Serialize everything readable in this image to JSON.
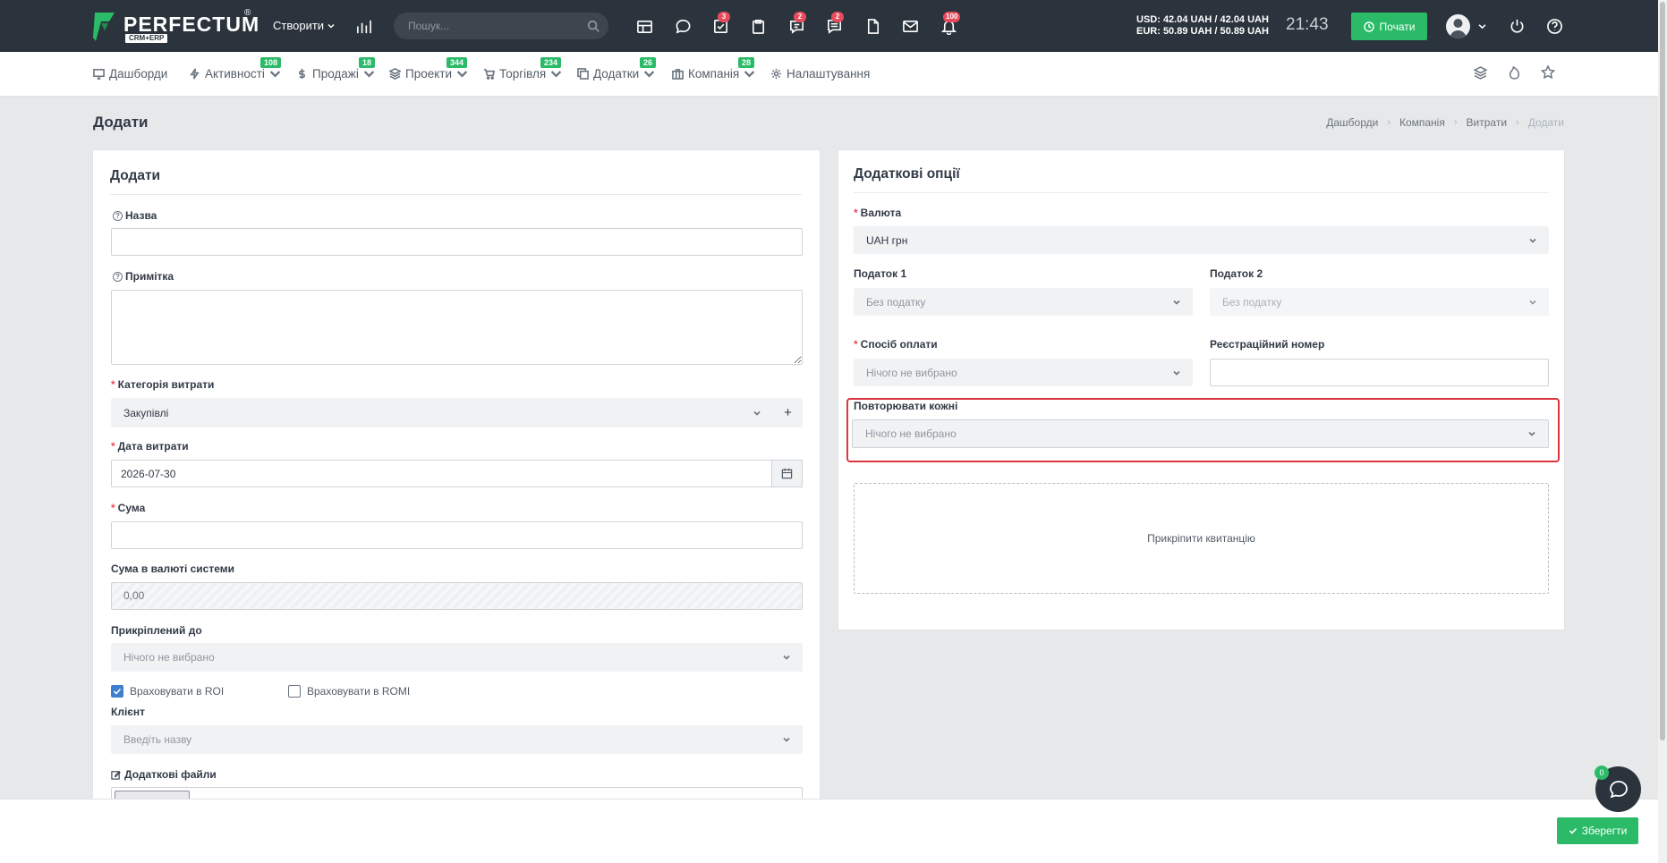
{
  "app": {
    "name": "PERFECTUM",
    "sub": "CRM+ERP",
    "reg": "®"
  },
  "topbar": {
    "create_label": "Створити",
    "search_placeholder": "Пошук...",
    "badges": {
      "tasks": "3",
      "comments": "2",
      "messages": "2",
      "notifications": "100"
    },
    "rates_usd": "USD: 42.04 UAH / 42.04 UAH",
    "rates_eur": "EUR: 50.89 UAH / 50.89 UAH",
    "time": "21:43",
    "start_label": "Почати"
  },
  "nav": [
    {
      "label": "Дашборди",
      "badge": ""
    },
    {
      "label": "Активності",
      "badge": "108"
    },
    {
      "label": "Продажі",
      "badge": "18"
    },
    {
      "label": "Проекти",
      "badge": "344"
    },
    {
      "label": "Торгівля",
      "badge": "234"
    },
    {
      "label": "Додатки",
      "badge": "26"
    },
    {
      "label": "Компанія",
      "badge": "28"
    },
    {
      "label": "Налаштування",
      "badge": ""
    }
  ],
  "page": {
    "title": "Додати",
    "breadcrumbs": [
      "Дашборди",
      "Компанія",
      "Витрати",
      "Додати"
    ]
  },
  "left": {
    "title": "Додати",
    "name_label": "Назва",
    "note_label": "Примітка",
    "category_label": "Категорія витрати",
    "category_value": "Закупівлі",
    "date_label": "Дата витрати",
    "date_value": "2026-07-30",
    "sum_label": "Сума",
    "sum_system_label": "Сума в валюті системи",
    "sum_system_value": "0,00",
    "attached_label": "Прикріплений до",
    "attached_placeholder": "Нічого не вибрано",
    "roi_label": "Враховувати в ROI",
    "romi_label": "Враховувати в ROMI",
    "client_label": "Клієнт",
    "client_placeholder": "Введіть назву",
    "files_label": "Додаткові файли"
  },
  "right": {
    "title": "Додаткові опції",
    "currency_label": "Валюта",
    "currency_value": "UAH грн",
    "tax1_label": "Податок 1",
    "tax1_value": "Без податку",
    "tax2_label": "Податок 2",
    "tax2_value": "Без податку",
    "payment_label": "Спосіб оплати",
    "payment_placeholder": "Нічого не вибрано",
    "reg_label": "Реєстраційний номер",
    "repeat_label": "Повторювати кожні",
    "repeat_placeholder": "Нічого не вибрано",
    "attach_receipt": "Прикріпити квитанцію"
  },
  "footer": {
    "save_label": "Зберегти",
    "chat_badge": "0"
  },
  "colors": {
    "accent": "#2bbb68",
    "topbar": "#2b343d",
    "badge": "#ea4b5c",
    "highlight": "#d9363e"
  }
}
